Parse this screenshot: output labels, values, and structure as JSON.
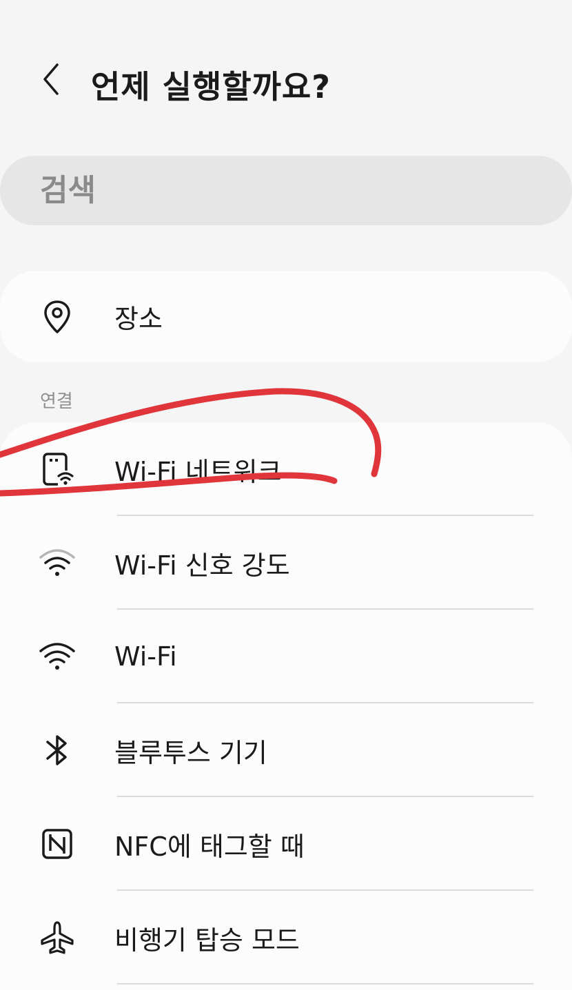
{
  "header": {
    "title": "언제 실행할까요?",
    "back_icon": "chevron-left-icon"
  },
  "search": {
    "placeholder": "검색"
  },
  "place_section": {
    "items": [
      {
        "label": "장소",
        "icon": "location-pin-icon"
      }
    ]
  },
  "connection_section": {
    "label": "연결",
    "items": [
      {
        "label": "Wi-Fi 네트워크",
        "icon": "wifi-network-icon"
      },
      {
        "label": "Wi-Fi 신호 강도",
        "icon": "wifi-signal-strength-icon"
      },
      {
        "label": "Wi-Fi",
        "icon": "wifi-icon"
      },
      {
        "label": "블루투스 기기",
        "icon": "bluetooth-icon"
      },
      {
        "label": "NFC에 태그할 때",
        "icon": "nfc-icon"
      },
      {
        "label": "비행기 탑승 모드",
        "icon": "airplane-icon"
      }
    ]
  },
  "colors": {
    "background": "#f5f5f5",
    "card": "#fcfcfc",
    "search_bg": "#e6e6e6",
    "annotation_red": "#e0353b"
  }
}
